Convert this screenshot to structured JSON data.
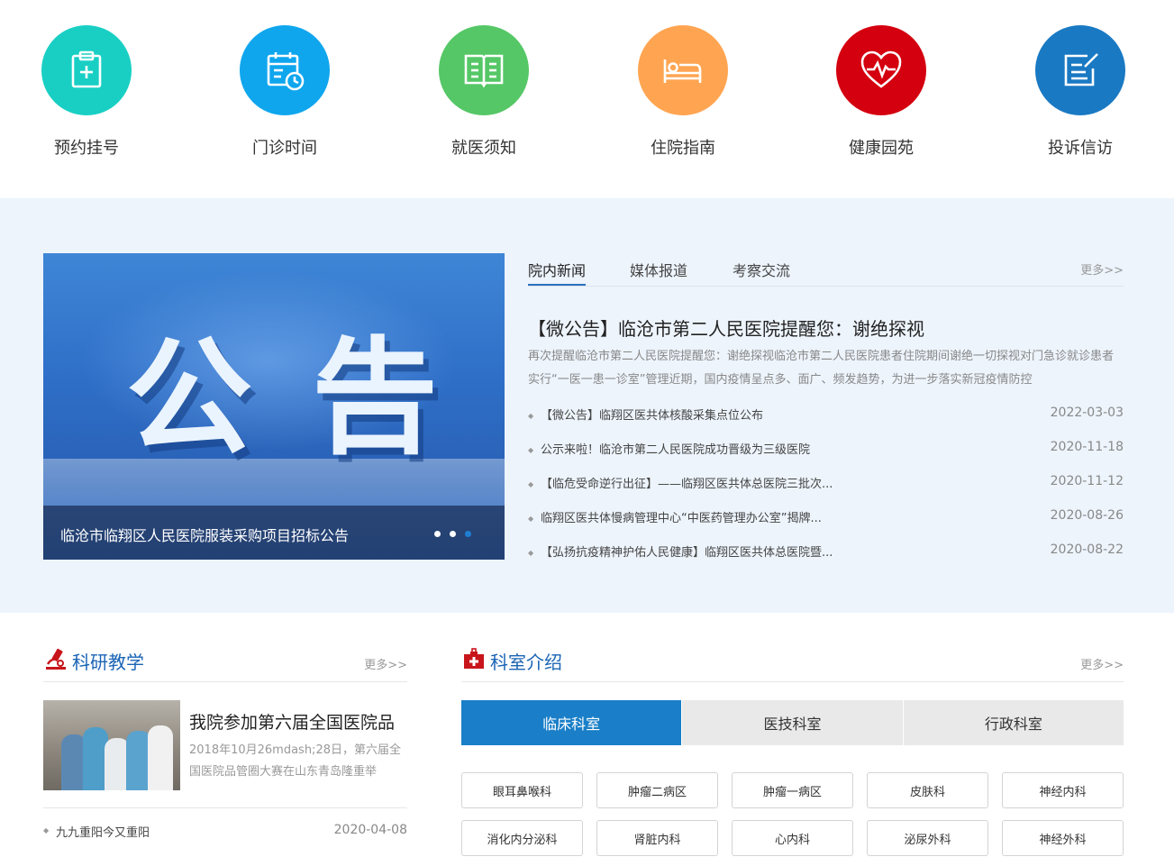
{
  "quick_links": [
    {
      "label": "预约挂号",
      "icon": "clipboard-plus-icon",
      "color": "#19cfc4"
    },
    {
      "label": "门诊时间",
      "icon": "calendar-clock-icon",
      "color": "#0fa6ee"
    },
    {
      "label": "就医须知",
      "icon": "open-book-icon",
      "color": "#55c766"
    },
    {
      "label": "住院指南",
      "icon": "hospital-bed-icon",
      "color": "#ffa552"
    },
    {
      "label": "健康园苑",
      "icon": "heart-pulse-icon",
      "color": "#d4000f"
    },
    {
      "label": "投诉信访",
      "icon": "edit-form-icon",
      "color": "#1a79c3"
    }
  ],
  "banner": {
    "chars": [
      "公",
      "告"
    ],
    "caption": "临沧市临翔区人民医院服装采购项目招标公告",
    "slides": 3,
    "active_slide": 3
  },
  "news": {
    "tabs": [
      "院内新闻",
      "媒体报道",
      "考察交流"
    ],
    "active_tab": 0,
    "more": "更多>>",
    "headline": "【微公告】临沧市第二人民医院提醒您：谢绝探视",
    "summary": "再次提醒临沧市第二人民医院提醒您：谢绝探视临沧市第二人民医院患者住院期间谢绝一切探视对门急诊就诊患者实行“一医一患一诊室”管理近期，国内疫情呈点多、面广、频发趋势，为进一步落实新冠疫情防控",
    "items": [
      {
        "title": "【微公告】临翔区医共体核酸采集点位公布",
        "date": "2022-03-03"
      },
      {
        "title": "公示来啦！临沧市第二人民医院成功晋级为三级医院",
        "date": "2020-11-18"
      },
      {
        "title": "【临危受命逆行出征】——临翔区医共体总医院三批次...",
        "date": "2020-11-12"
      },
      {
        "title": "临翔区医共体慢病管理中心“中医药管理办公室”揭牌...",
        "date": "2020-08-26"
      },
      {
        "title": "【弘扬抗疫精神护佑人民健康】临翔区医共体总医院暨...",
        "date": "2020-08-22"
      }
    ]
  },
  "research": {
    "title": "科研教学",
    "icon": "microscope-icon",
    "more": "更多>>",
    "feature_title": "我院参加第六届全国医院品",
    "feature_desc": "2018年10月26mdash;28日，第六届全国医院品管圈大赛在山东青岛隆重举",
    "items": [
      {
        "title": "九九重阳今又重阳",
        "date": "2020-04-08"
      }
    ]
  },
  "departments": {
    "title": "科室介绍",
    "icon": "medical-kit-icon",
    "more": "更多>>",
    "tabs": [
      "临床科室",
      "医技科室",
      "行政科室"
    ],
    "active_tab": 0,
    "items": [
      "眼耳鼻喉科",
      "肿瘤二病区",
      "肿瘤一病区",
      "皮肤科",
      "神经内科",
      "消化内分泌科",
      "肾脏内科",
      "心内科",
      "泌尿外科",
      "神经外科"
    ]
  },
  "colors": {
    "accent": "#1a7fc8",
    "title_blue": "#1a64b5",
    "icon_red": "#c8151b",
    "band_bg": "#edf4fc"
  }
}
